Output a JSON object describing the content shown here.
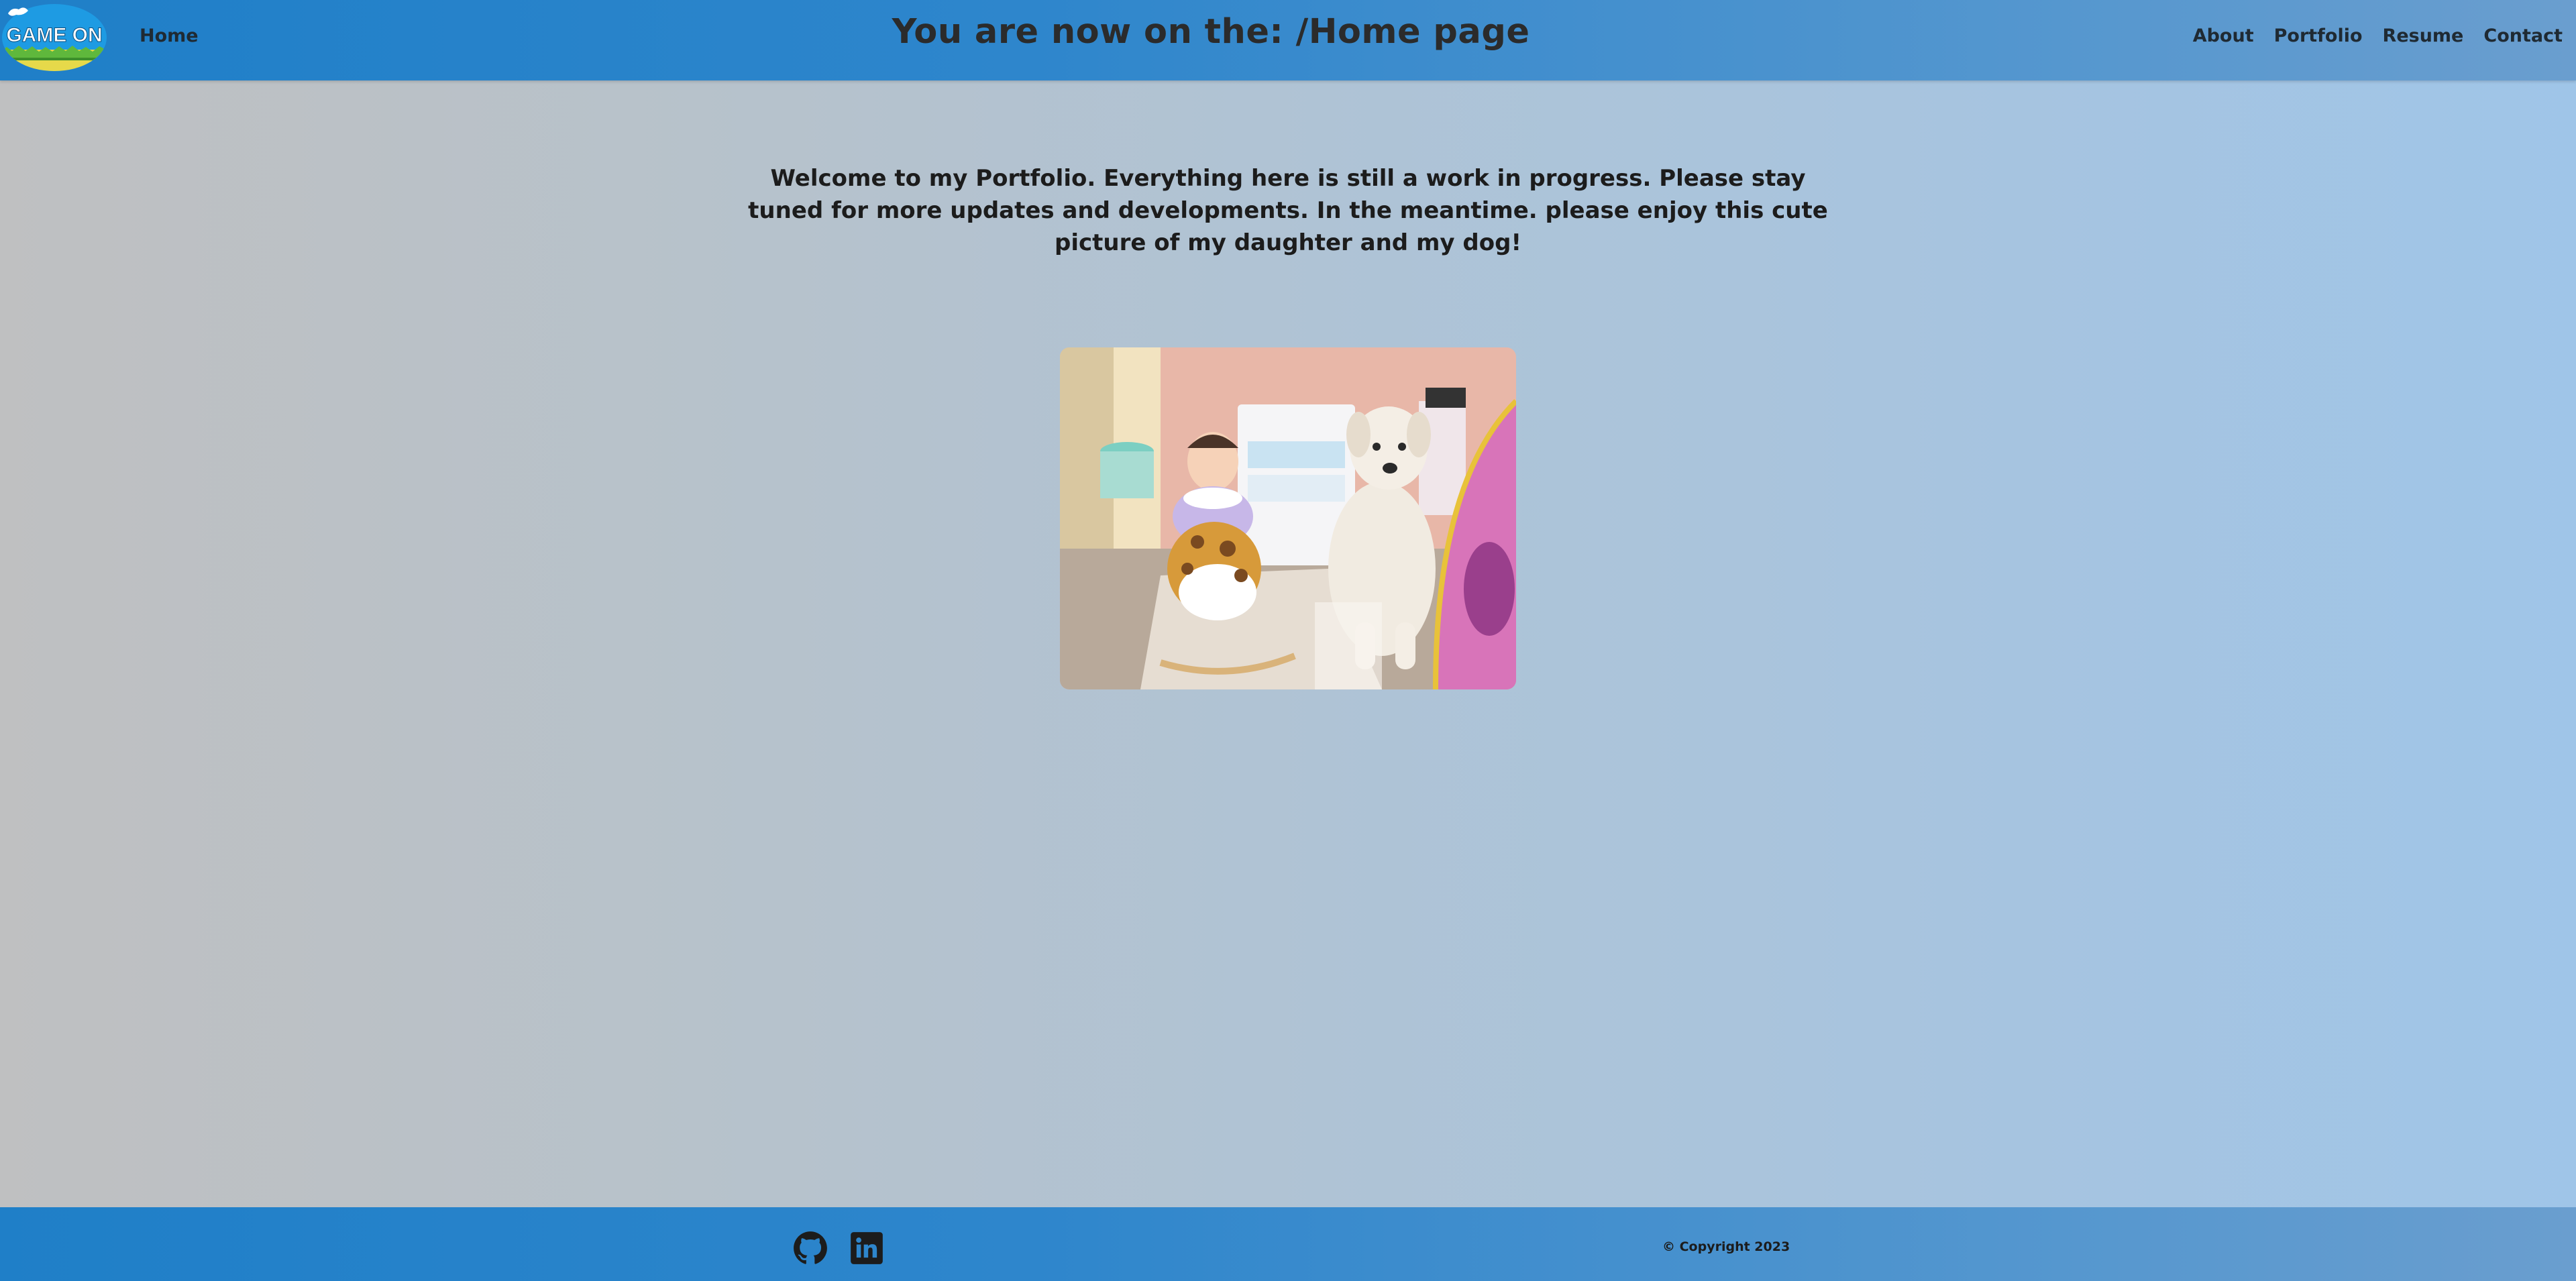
{
  "header": {
    "logo_text": "GAME ON",
    "home_label": "Home",
    "title": "You are now on the: /Home page",
    "nav": [
      {
        "label": "About"
      },
      {
        "label": "Portfolio"
      },
      {
        "label": "Resume"
      },
      {
        "label": "Contact"
      }
    ]
  },
  "main": {
    "welcome_text": "Welcome to my Portfolio. Everything here is still a work in progress. Please stay tuned for more updates and developments. In the meantime. please enjoy this cute picture of my daughter and my dog!"
  },
  "footer": {
    "social": [
      {
        "icon": "github-icon"
      },
      {
        "icon": "linkedin-icon"
      }
    ],
    "copyright": "© Copyright 2023"
  },
  "colors": {
    "header_bg": "#2e86cc",
    "text_dark": "#1f2a33"
  }
}
